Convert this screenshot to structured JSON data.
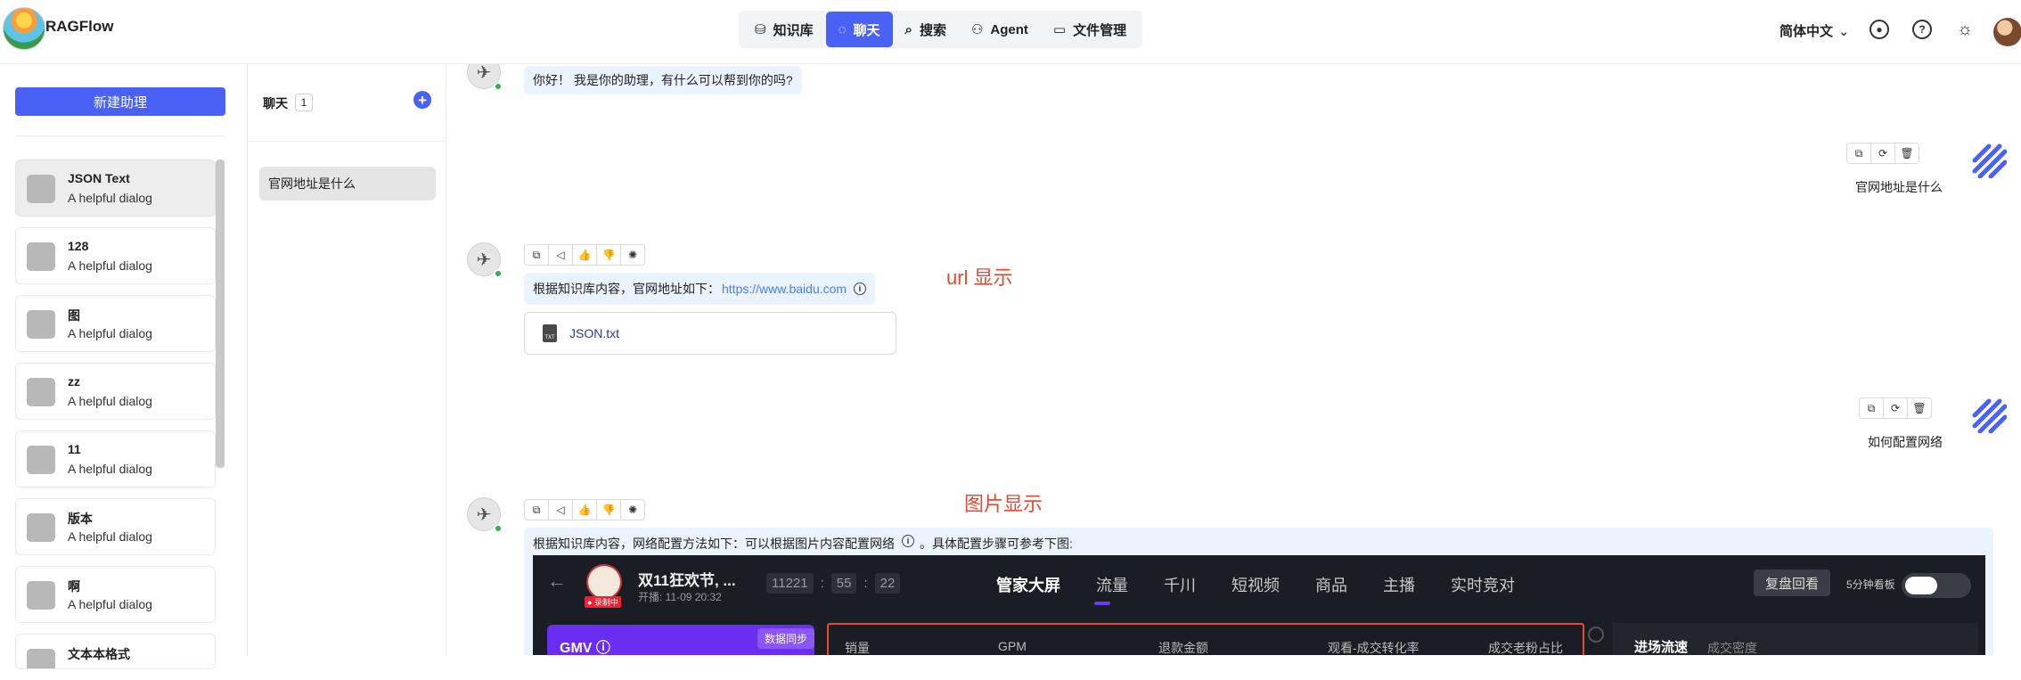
{
  "app": {
    "name": "RAGFlow"
  },
  "nav": [
    {
      "label": "知识库",
      "icon": "database-icon",
      "glyph": "⛁",
      "active": false
    },
    {
      "label": "聊天",
      "icon": "chat-icon",
      "glyph": "◌",
      "active": true
    },
    {
      "label": "搜索",
      "icon": "search-icon",
      "glyph": "⌕",
      "active": false
    },
    {
      "label": "Agent",
      "icon": "agent-icon",
      "glyph": "⚇",
      "active": false
    },
    {
      "label": "文件管理",
      "icon": "folder-icon",
      "glyph": "▭",
      "active": false
    }
  ],
  "header": {
    "language": "简体中文",
    "icons": [
      "github-icon",
      "help-icon",
      "theme-icon"
    ]
  },
  "sidebar": {
    "new_button": "新建助理",
    "assistants": [
      {
        "name": "JSON Text",
        "desc": "A helpful dialog",
        "active": true
      },
      {
        "name": "128",
        "desc": "A helpful dialog"
      },
      {
        "name": "图",
        "desc": "A helpful dialog"
      },
      {
        "name": "zz",
        "desc": "A helpful dialog"
      },
      {
        "name": "11",
        "desc": "A helpful dialog"
      },
      {
        "name": "版本",
        "desc": "A helpful dialog"
      },
      {
        "name": "啊",
        "desc": "A helpful dialog"
      },
      {
        "name": "文本本格式",
        "desc": ""
      }
    ]
  },
  "chat_panel": {
    "title": "聊天",
    "count": "1",
    "conversations": [
      "官网地址是什么"
    ]
  },
  "messages": {
    "greeting": "你好！ 我是你的助理，有什么可以帮到你的吗?",
    "user1": "官网地址是什么",
    "answer1_prefix": "根据知识库内容，官网地址如下：",
    "answer1_link": "https://www.baidu.com",
    "answer1_file": "JSON.txt",
    "user2": "如何配置网络",
    "answer2_text": "根据知识库内容，网络配置方法如下：可以根据图片内容配置网络",
    "answer2_suffix": "。具体配置步骤可参考下图:",
    "annotation_url": "url 显示",
    "annotation_image": "图片显示"
  },
  "embedded_image": {
    "title": "双11狂欢节, ...",
    "subtitle": "开播: 11-09 20:32",
    "live_badge": "● 录制中",
    "timer": [
      "11221",
      "55",
      "22"
    ],
    "tabs": [
      "管家大屏",
      "流量",
      "千川",
      "短视频",
      "商品",
      "主播",
      "实时竞对"
    ],
    "replay": "复盘回看",
    "mini_label": "5分钟看板",
    "gmv_label": "GMV ⓘ",
    "sync_label": "数据同步",
    "metrics": [
      "销量",
      "GPM",
      "退款金额",
      "观看-成交转化率",
      "成交老粉占比"
    ],
    "right_tab_a": "进场流速",
    "right_tab_b": "成交密度"
  }
}
